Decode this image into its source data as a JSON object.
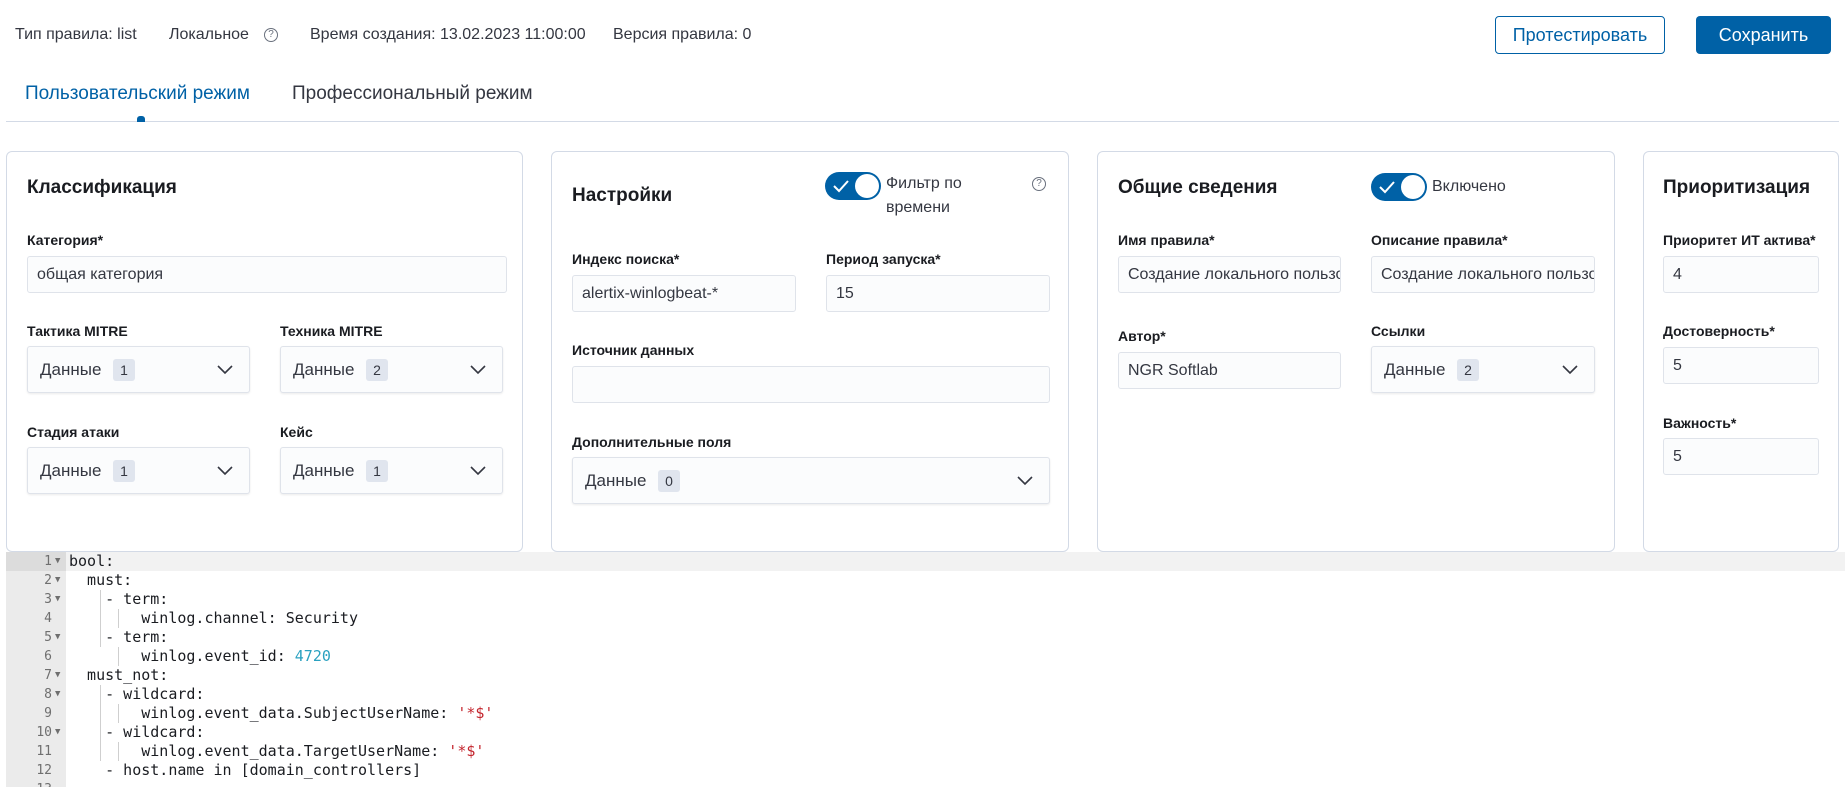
{
  "header": {
    "rule_type": "Тип правила: list",
    "locality": "Локальное",
    "created": "Время создания: 13.02.2023 11:00:00",
    "version": "Версия правила: 0",
    "test_button": "Протестировать",
    "save_button": "Сохранить"
  },
  "tabs": [
    {
      "label": "Пользовательский режим",
      "active": true
    },
    {
      "label": "Профессиональный режим",
      "active": false
    }
  ],
  "classification": {
    "title": "Классификация",
    "category_label": "Категория*",
    "category_value": "общая категория",
    "tactic_label": "Тактика MITRE",
    "tactic_text": "Данные",
    "tactic_count": "1",
    "technique_label": "Техника MITRE",
    "technique_text": "Данные",
    "technique_count": "2",
    "stage_label": "Стадия атаки",
    "stage_text": "Данные",
    "stage_count": "1",
    "case_label": "Кейс",
    "case_text": "Данные",
    "case_count": "1"
  },
  "settings": {
    "title": "Настройки",
    "time_filter_label_1": "Фильтр по",
    "time_filter_label_2": "времени",
    "time_filter_on": true,
    "index_label": "Индекс поиска*",
    "index_value": "alertix-winlogbeat-*",
    "period_label": "Период запуска*",
    "period_value": "15",
    "source_label": "Источник данных",
    "source_value": "",
    "extra_label": "Дополнительные поля",
    "extra_text": "Данные",
    "extra_count": "0"
  },
  "general": {
    "title": "Общие сведения",
    "enabled_label": "Включено",
    "enabled_on": true,
    "name_label": "Имя правила*",
    "name_value": "Создание локального пользователя",
    "desc_label": "Описание правила*",
    "desc_value": "Создание локального пользователя",
    "author_label": "Автор*",
    "author_value": "NGR Softlab",
    "links_label": "Ссылки",
    "links_text": "Данные",
    "links_count": "2"
  },
  "priority": {
    "title": "Приоритизация",
    "asset_label": "Приоритет ИТ актива*",
    "asset_value": "4",
    "confidence_label": "Достоверность*",
    "confidence_value": "5",
    "importance_label": "Важность*",
    "importance_value": "5"
  },
  "editor": {
    "lines": [
      {
        "n": "1",
        "fold": true,
        "parts": [
          [
            "t",
            "bool:"
          ]
        ]
      },
      {
        "n": "2",
        "fold": true,
        "parts": [
          [
            "t",
            "  must:"
          ]
        ]
      },
      {
        "n": "3",
        "fold": true,
        "parts": [
          [
            "t",
            "    - term:"
          ]
        ]
      },
      {
        "n": "4",
        "fold": false,
        "parts": [
          [
            "t",
            "        winlog.channel: Security"
          ]
        ]
      },
      {
        "n": "5",
        "fold": true,
        "parts": [
          [
            "t",
            "    - term:"
          ]
        ]
      },
      {
        "n": "6",
        "fold": false,
        "parts": [
          [
            "t",
            "        winlog.event_id: "
          ],
          [
            "num",
            "4720"
          ]
        ]
      },
      {
        "n": "7",
        "fold": true,
        "parts": [
          [
            "t",
            "  must_not:"
          ]
        ]
      },
      {
        "n": "8",
        "fold": true,
        "parts": [
          [
            "t",
            "    - wildcard:"
          ]
        ]
      },
      {
        "n": "9",
        "fold": false,
        "parts": [
          [
            "t",
            "        winlog.event_data.SubjectUserName: "
          ],
          [
            "str",
            "'*$'"
          ]
        ]
      },
      {
        "n": "10",
        "fold": true,
        "parts": [
          [
            "t",
            "    - wildcard:"
          ]
        ]
      },
      {
        "n": "11",
        "fold": false,
        "parts": [
          [
            "t",
            "        winlog.event_data.TargetUserName: "
          ],
          [
            "str",
            "'*$'"
          ]
        ]
      },
      {
        "n": "12",
        "fold": false,
        "parts": [
          [
            "t",
            "    - host.name in [domain_controllers]"
          ]
        ]
      },
      {
        "n": "13",
        "fold": false,
        "parts": [
          [
            "t",
            ""
          ]
        ]
      }
    ]
  },
  "colors": {
    "accent": "#0061a6",
    "border": "#d3dae6",
    "badge": "#e0e5ee",
    "code_number": "#2aa1c0",
    "code_string": "#c4262e"
  }
}
